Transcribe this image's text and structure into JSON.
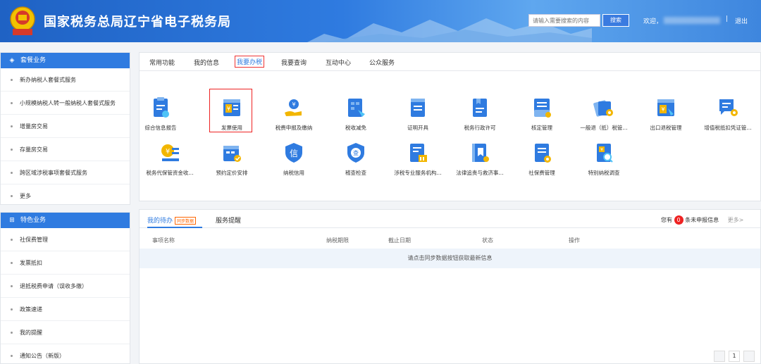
{
  "header": {
    "title": "国家税务总局辽宁省电子税务局",
    "search_placeholder": "请输入需要搜索的内容",
    "search_button": "搜索",
    "welcome": "欢迎，",
    "separator": "|",
    "logout": "退出"
  },
  "sidebar": {
    "package": {
      "title": "套餐业务",
      "items": [
        "新办纳税人套餐式服务",
        "小规模纳税人转一般纳税人套餐式服务",
        "增量房交易",
        "存量房交易",
        "跨区域涉税事项套餐式服务",
        "更多"
      ]
    },
    "special": {
      "title": "特色业务",
      "items": [
        "社保费管理",
        "发票抵扣",
        "退抵税费申请（误收多缴）",
        "政策速递",
        "我的提醒",
        "通知公告（新版）"
      ]
    }
  },
  "main_tabs": [
    "常用功能",
    "我的信息",
    "我要办税",
    "我要查询",
    "互动中心",
    "公众服务"
  ],
  "apps_row1": [
    "综合信息报告",
    "发票使用",
    "税费申报及缴纳",
    "税收减免",
    "证明开具",
    "税务行政许可",
    "核定管理",
    "一般退（抵）税管...",
    "出口退税管理",
    "增值税抵扣凭证管..."
  ],
  "apps_row2": [
    "税务代保管资金收...",
    "预约定价安排",
    "纳税信用",
    "稽查检查",
    "涉税专业服务机构...",
    "法律追责与救济事...",
    "社保费管理",
    "特别纳税调查"
  ],
  "icons": {
    "xin": "信",
    "cha": "查",
    "yuan": "¥"
  },
  "todo": {
    "tab_mine": "我的待办",
    "sync_badge": "同步数据",
    "tab_reminders": "服务提醒",
    "unreported_prefix": "您有",
    "unreported_count": "0",
    "unreported_suffix": "条未申报信息",
    "more": "更多>",
    "columns": [
      "事项名称",
      "纳税期限",
      "截止日期",
      "状态",
      "操作"
    ],
    "empty_text": "请点击同步数据按钮获取最新信息",
    "page": "1"
  },
  "colors": {
    "primary": "#2f7be0",
    "highlight": "#e22222",
    "badge": "#ff6600"
  }
}
